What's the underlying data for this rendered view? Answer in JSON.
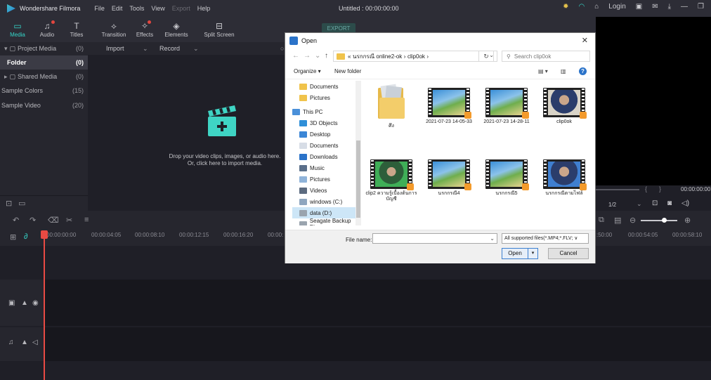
{
  "app": {
    "name": "Wondershare Filmora",
    "project_title": "Untitled : 00:00:00:00"
  },
  "menu": [
    "File",
    "Edit",
    "Tools",
    "View",
    "Export",
    "Help"
  ],
  "topright": {
    "login": "Login"
  },
  "toolbar": {
    "media": "Media",
    "audio": "Audio",
    "titles": "Titles",
    "transition": "Transition",
    "effects": "Effects",
    "elements": "Elements",
    "split": "Split Screen",
    "export": "EXPORT"
  },
  "library": {
    "items": [
      {
        "label": "Project Media",
        "count": "(0)"
      },
      {
        "label": "Folder",
        "count": "(0)"
      },
      {
        "label": "Shared Media",
        "count": "(0)"
      },
      {
        "label": "Sample Colors",
        "count": "(15)"
      },
      {
        "label": "Sample Video",
        "count": "(20)"
      }
    ],
    "import": "Import",
    "record": "Record",
    "drop_line1": "Drop your video clips, images, or audio here.",
    "drop_line2": "Or, click here to import media."
  },
  "preview": {
    "time": "00:00:00:00",
    "scale": "1/2"
  },
  "timeline": {
    "ticks": [
      "00:00:00:00",
      "00:00:04:05",
      "00:00:08:10",
      "00:00:12:15",
      "00:00:16:20",
      "00:00:",
      ":50:00",
      "00:00:54:05",
      "00:00:58:10"
    ]
  },
  "dialog": {
    "title": "Open",
    "path": [
      "«",
      "นรกกรณี online2-ok",
      "›",
      "clip0ok",
      "›"
    ],
    "search_placeholder": "Search clip0ok",
    "organize": "Organize ▾",
    "new_folder": "New folder",
    "nav": [
      "Documents",
      "Pictures",
      "This PC",
      "3D Objects",
      "Desktop",
      "Documents",
      "Downloads",
      "Music",
      "Pictures",
      "Videos",
      "windows (C:)",
      "data (D:)",
      "Seagate Backup Plu"
    ],
    "files": [
      {
        "name": "ศึง",
        "kind": "folder"
      },
      {
        "name": "2021-07-23 14-05-33",
        "kind": "video"
      },
      {
        "name": "2021-07-23 14-28-11",
        "kind": "video"
      },
      {
        "name": "clip0ok",
        "kind": "video"
      },
      {
        "name": "clip2 ความรู้เบื้องต้นการบัญชี",
        "kind": "video"
      },
      {
        "name": "นรกกรณี4",
        "kind": "video"
      },
      {
        "name": "นรกกรณี5",
        "kind": "video"
      },
      {
        "name": "นรกกรณีตามไฟล์",
        "kind": "video"
      }
    ],
    "file_name_label": "File name:",
    "file_type": "All supported files(*.MP4;*.FLV; ∨",
    "open": "Open",
    "cancel": "Cancel"
  }
}
